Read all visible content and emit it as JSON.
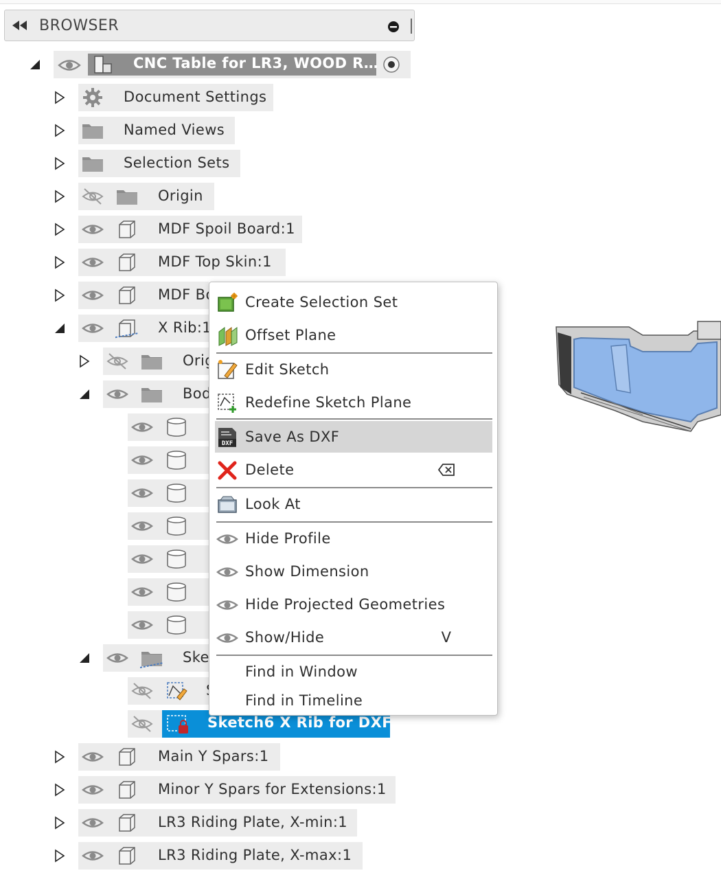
{
  "browser": {
    "title": "BROWSER",
    "root": {
      "label": "CNC Table for LR3, WOOD R…"
    },
    "rows": [
      {
        "label": "Document Settings"
      },
      {
        "label": "Named Views"
      },
      {
        "label": "Selection Sets"
      },
      {
        "label": "Origin"
      },
      {
        "label": "MDF Spoil Board:1"
      },
      {
        "label": "MDF Top Skin:1"
      },
      {
        "label": "MDF Bo"
      },
      {
        "label": "X Rib:1"
      },
      {
        "label": "Orig"
      },
      {
        "label": "Bod"
      },
      {
        "label": "Ske"
      },
      {
        "label": "Main Y Spars:1"
      },
      {
        "label": "Minor Y Spars for Extensions:1"
      },
      {
        "label": "LR3 Riding Plate, X-min:1"
      },
      {
        "label": "LR3 Riding Plate, X-max:1"
      }
    ],
    "sketch_faded": "S",
    "selected": {
      "label": "Sketch6 X Rib for DXF"
    }
  },
  "context_menu": {
    "items": [
      {
        "label": "Create Selection Set",
        "icon": "create-selection-set-icon"
      },
      {
        "label": "Offset Plane",
        "icon": "offset-plane-icon"
      },
      {
        "label": "Edit Sketch",
        "icon": "edit-sketch-icon"
      },
      {
        "label": "Redefine Sketch Plane",
        "icon": "redefine-sketch-plane-icon"
      },
      {
        "label": "Save As DXF",
        "icon": "dxf-icon",
        "highlighted": true
      },
      {
        "label": "Delete",
        "icon": "delete-icon",
        "shortcut_icon": "backspace-key-icon"
      },
      {
        "label": "Look At",
        "icon": "look-at-icon"
      },
      {
        "label": "Hide Profile",
        "icon": "eye-icon"
      },
      {
        "label": "Show Dimension",
        "icon": "eye-icon"
      },
      {
        "label": "Hide Projected Geometries",
        "icon": "eye-icon"
      },
      {
        "label": "Show/Hide",
        "icon": "eye-icon",
        "shortcut": "V"
      },
      {
        "label": "Find in Window"
      },
      {
        "label": "Find in Timeline"
      }
    ]
  },
  "colors": {
    "selection_blue": "#0a8fd8",
    "row_bg": "#ececec",
    "menu_highlight": "#d6d6d6",
    "delete_red": "#e0241b"
  }
}
